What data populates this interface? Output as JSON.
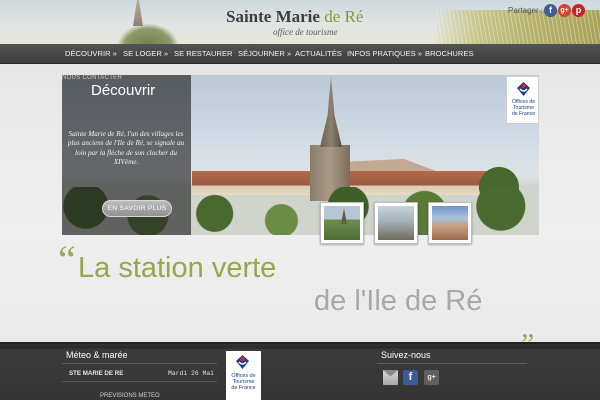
{
  "header": {
    "brand_name": "Sainte Marie",
    "brand_accent": "de Ré",
    "brand_subtitle": "office de tourisme",
    "share_label": "Partager :",
    "social": [
      "facebook-icon",
      "google-plus-icon",
      "pinterest-icon"
    ]
  },
  "nav": {
    "items": [
      {
        "label": "DÉCOUVRIR »"
      },
      {
        "label": "SE LOGER »"
      },
      {
        "label": "SE RESTAURER"
      },
      {
        "label": "SÉJOURNER »"
      },
      {
        "label": "ACTUALITÉS"
      },
      {
        "label": "INFOS PRATIQUES »"
      },
      {
        "label": "BROCHURES"
      }
    ]
  },
  "slider": {
    "kicker": "NOUS CONTACTER",
    "title": "Découvrir",
    "text": "Sainte Marie de Ré, l'un des villages les plus anciens de l'Ile de Ré, se signale au loin par la flèche de son clocher du XIVème.",
    "button_label": "EN SAVOIR PLUS",
    "badge_text": [
      "Offices de",
      "Tourisme",
      "de France"
    ]
  },
  "tagline": {
    "line1": "La station verte",
    "line2": "de l'Ile de Ré",
    "quote_open": "“",
    "quote_close": "„"
  },
  "footer": {
    "weather_title": "Méteo & marée",
    "place": "STE MARIE DE RE",
    "date": "Mardi 26 Mai",
    "forecast_label": "PREVISIONS METEO",
    "badge_text": [
      "Offices de",
      "Tourisme",
      "de France"
    ],
    "follow_title": "Suivez-nous",
    "follow_icons": [
      "mail-icon",
      "facebook-icon",
      "google-plus-icon"
    ]
  },
  "colors": {
    "accent_green": "#93a84a",
    "nav_bg": "#474747",
    "footer_bg": "#353535",
    "facebook": "#3b5b9a",
    "pinterest": "#c8232c"
  }
}
